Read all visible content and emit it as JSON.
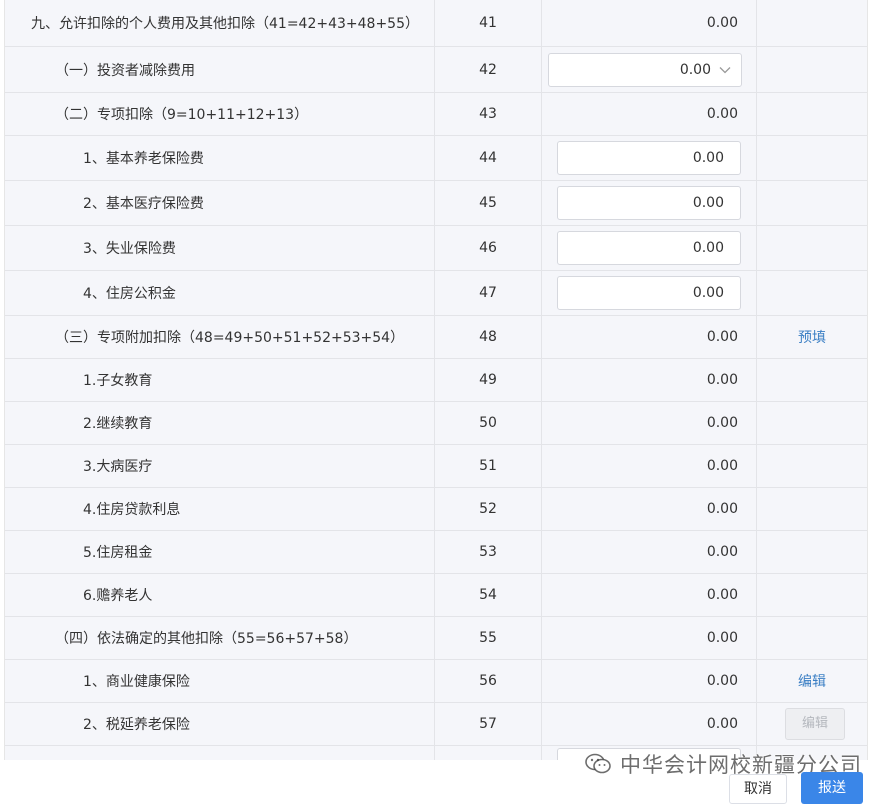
{
  "rows": [
    {
      "name": "九、允许扣除的个人费用及其他扣除（41=42+43+48+55）",
      "no": "41",
      "amount": "0.00"
    },
    {
      "name": "（一）投资者减除费用",
      "no": "42",
      "amount": "0.00"
    },
    {
      "name": "（二）专项扣除（9=10+11+12+13）",
      "no": "43",
      "amount": "0.00"
    },
    {
      "name": "1、基本养老保险费",
      "no": "44",
      "amount": "0.00"
    },
    {
      "name": "2、基本医疗保险费",
      "no": "45",
      "amount": "0.00"
    },
    {
      "name": "3、失业保险费",
      "no": "46",
      "amount": "0.00"
    },
    {
      "name": "4、住房公积金",
      "no": "47",
      "amount": "0.00"
    },
    {
      "name": "（三）专项附加扣除（48=49+50+51+52+53+54）",
      "no": "48",
      "amount": "0.00",
      "action": "预填"
    },
    {
      "name": "1.子女教育",
      "no": "49",
      "amount": "0.00"
    },
    {
      "name": "2.继续教育",
      "no": "50",
      "amount": "0.00"
    },
    {
      "name": "3.大病医疗",
      "no": "51",
      "amount": "0.00"
    },
    {
      "name": "4.住房贷款利息",
      "no": "52",
      "amount": "0.00"
    },
    {
      "name": "5.住房租金",
      "no": "53",
      "amount": "0.00"
    },
    {
      "name": "6.赡养老人",
      "no": "54",
      "amount": "0.00"
    },
    {
      "name": "（四）依法确定的其他扣除（55=56+57+58）",
      "no": "55",
      "amount": "0.00"
    },
    {
      "name": "1、商业健康保险",
      "no": "56",
      "amount": "0.00",
      "action": "编辑"
    },
    {
      "name": "2、税延养老保险",
      "no": "57",
      "amount": "0.00",
      "action": "编辑"
    }
  ],
  "footer": {
    "cancel_label": "取消",
    "submit_label": "报送"
  },
  "watermark": {
    "text": "中华会计网校新疆分公司"
  },
  "colors": {
    "link": "#3b7fc4",
    "primary_button": "#3a86e8",
    "row_background": "#f5f6fa"
  }
}
